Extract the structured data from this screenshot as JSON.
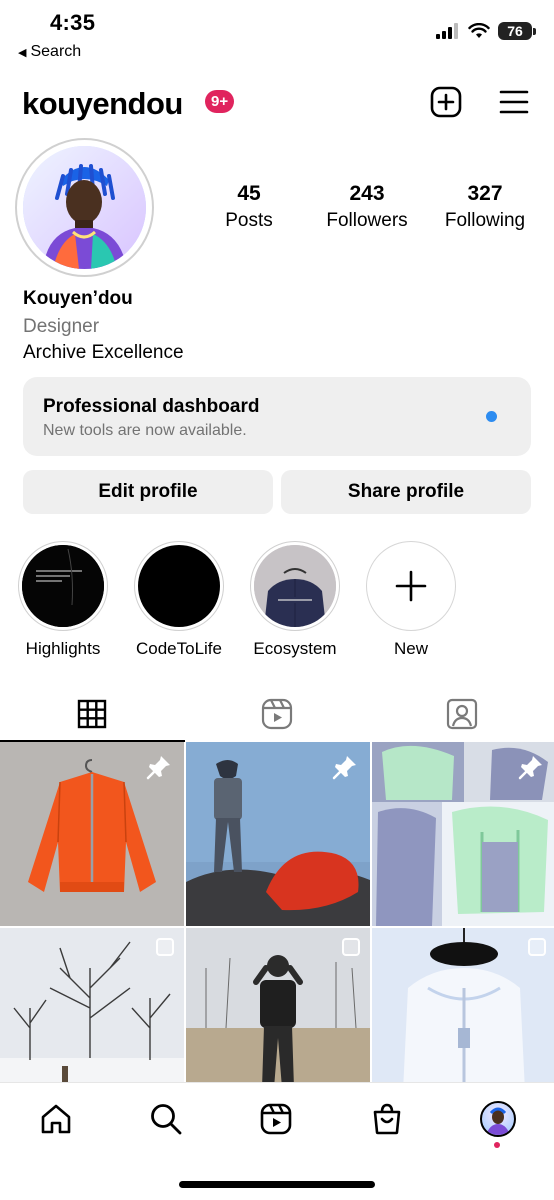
{
  "status_bar": {
    "time": "4:35",
    "back_label": "Search",
    "battery": "76"
  },
  "header": {
    "username": "kouyendou",
    "notification_badge": "9+"
  },
  "profile": {
    "stats": [
      {
        "value": "45",
        "label": "Posts"
      },
      {
        "value": "243",
        "label": "Followers"
      },
      {
        "value": "327",
        "label": "Following"
      }
    ],
    "name": "Kouyen’dou",
    "category": "Designer",
    "bio": "Archive Excellence"
  },
  "dashboard": {
    "title": "Professional dashboard",
    "subtitle": "New tools are now available.",
    "dot_color": "#2d8cf0"
  },
  "actions": {
    "edit": "Edit profile",
    "share": "Share profile"
  },
  "highlights": [
    {
      "label": "Highlights"
    },
    {
      "label": "CodeToLife"
    },
    {
      "label": "Ecosystem"
    },
    {
      "label": "New"
    }
  ],
  "tabs": [
    {
      "icon": "grid-icon",
      "active": true
    },
    {
      "icon": "reels-icon",
      "active": false
    },
    {
      "icon": "tagged-icon",
      "active": false
    }
  ],
  "grid_posts": [
    {
      "subject": "orange jacket on hanger",
      "marker": "pin-icon"
    },
    {
      "subject": "person standing on rocks with red jacket",
      "marker": "pin-icon"
    },
    {
      "subject": "green vest collage",
      "marker": "pin-icon"
    },
    {
      "subject": "snowy trees",
      "marker": "select-box"
    },
    {
      "subject": "person in dry grass field",
      "marker": "select-box"
    },
    {
      "subject": "white jacket collar on hanger",
      "marker": "select-box"
    }
  ],
  "bottom_nav": [
    {
      "icon": "home-icon"
    },
    {
      "icon": "search-icon"
    },
    {
      "icon": "reels-icon"
    },
    {
      "icon": "shop-icon"
    },
    {
      "icon": "profile-avatar"
    }
  ],
  "colors": {
    "badge": "#e0245e",
    "surface": "#efefef",
    "muted_text": "#737373"
  }
}
